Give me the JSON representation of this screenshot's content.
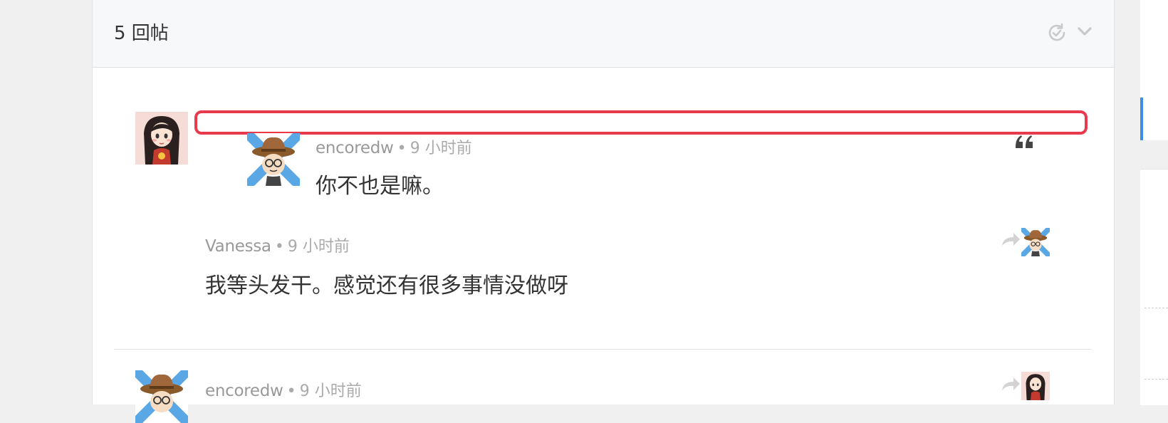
{
  "header": {
    "reply_count": "5 回帖"
  },
  "quoted_post": {
    "author": "encoredw",
    "separator": "•",
    "time": "9 小时前",
    "text": "你不也是嘛。"
  },
  "reply": {
    "author": "Vanessa",
    "separator": "•",
    "time": "9 小时前",
    "text": "我等头发干。感觉还有很多事情没做呀"
  },
  "next_post": {
    "author": "encoredw",
    "separator": "•",
    "time": "9 小时前"
  },
  "colors": {
    "highlight": "#e8394d",
    "accent_blue": "#3b8ee8",
    "meta_gray": "#aaaaaa"
  },
  "icons": [
    "refresh-check-icon",
    "chevron-down-icon",
    "quote-icon",
    "reply-arrow-icon"
  ]
}
